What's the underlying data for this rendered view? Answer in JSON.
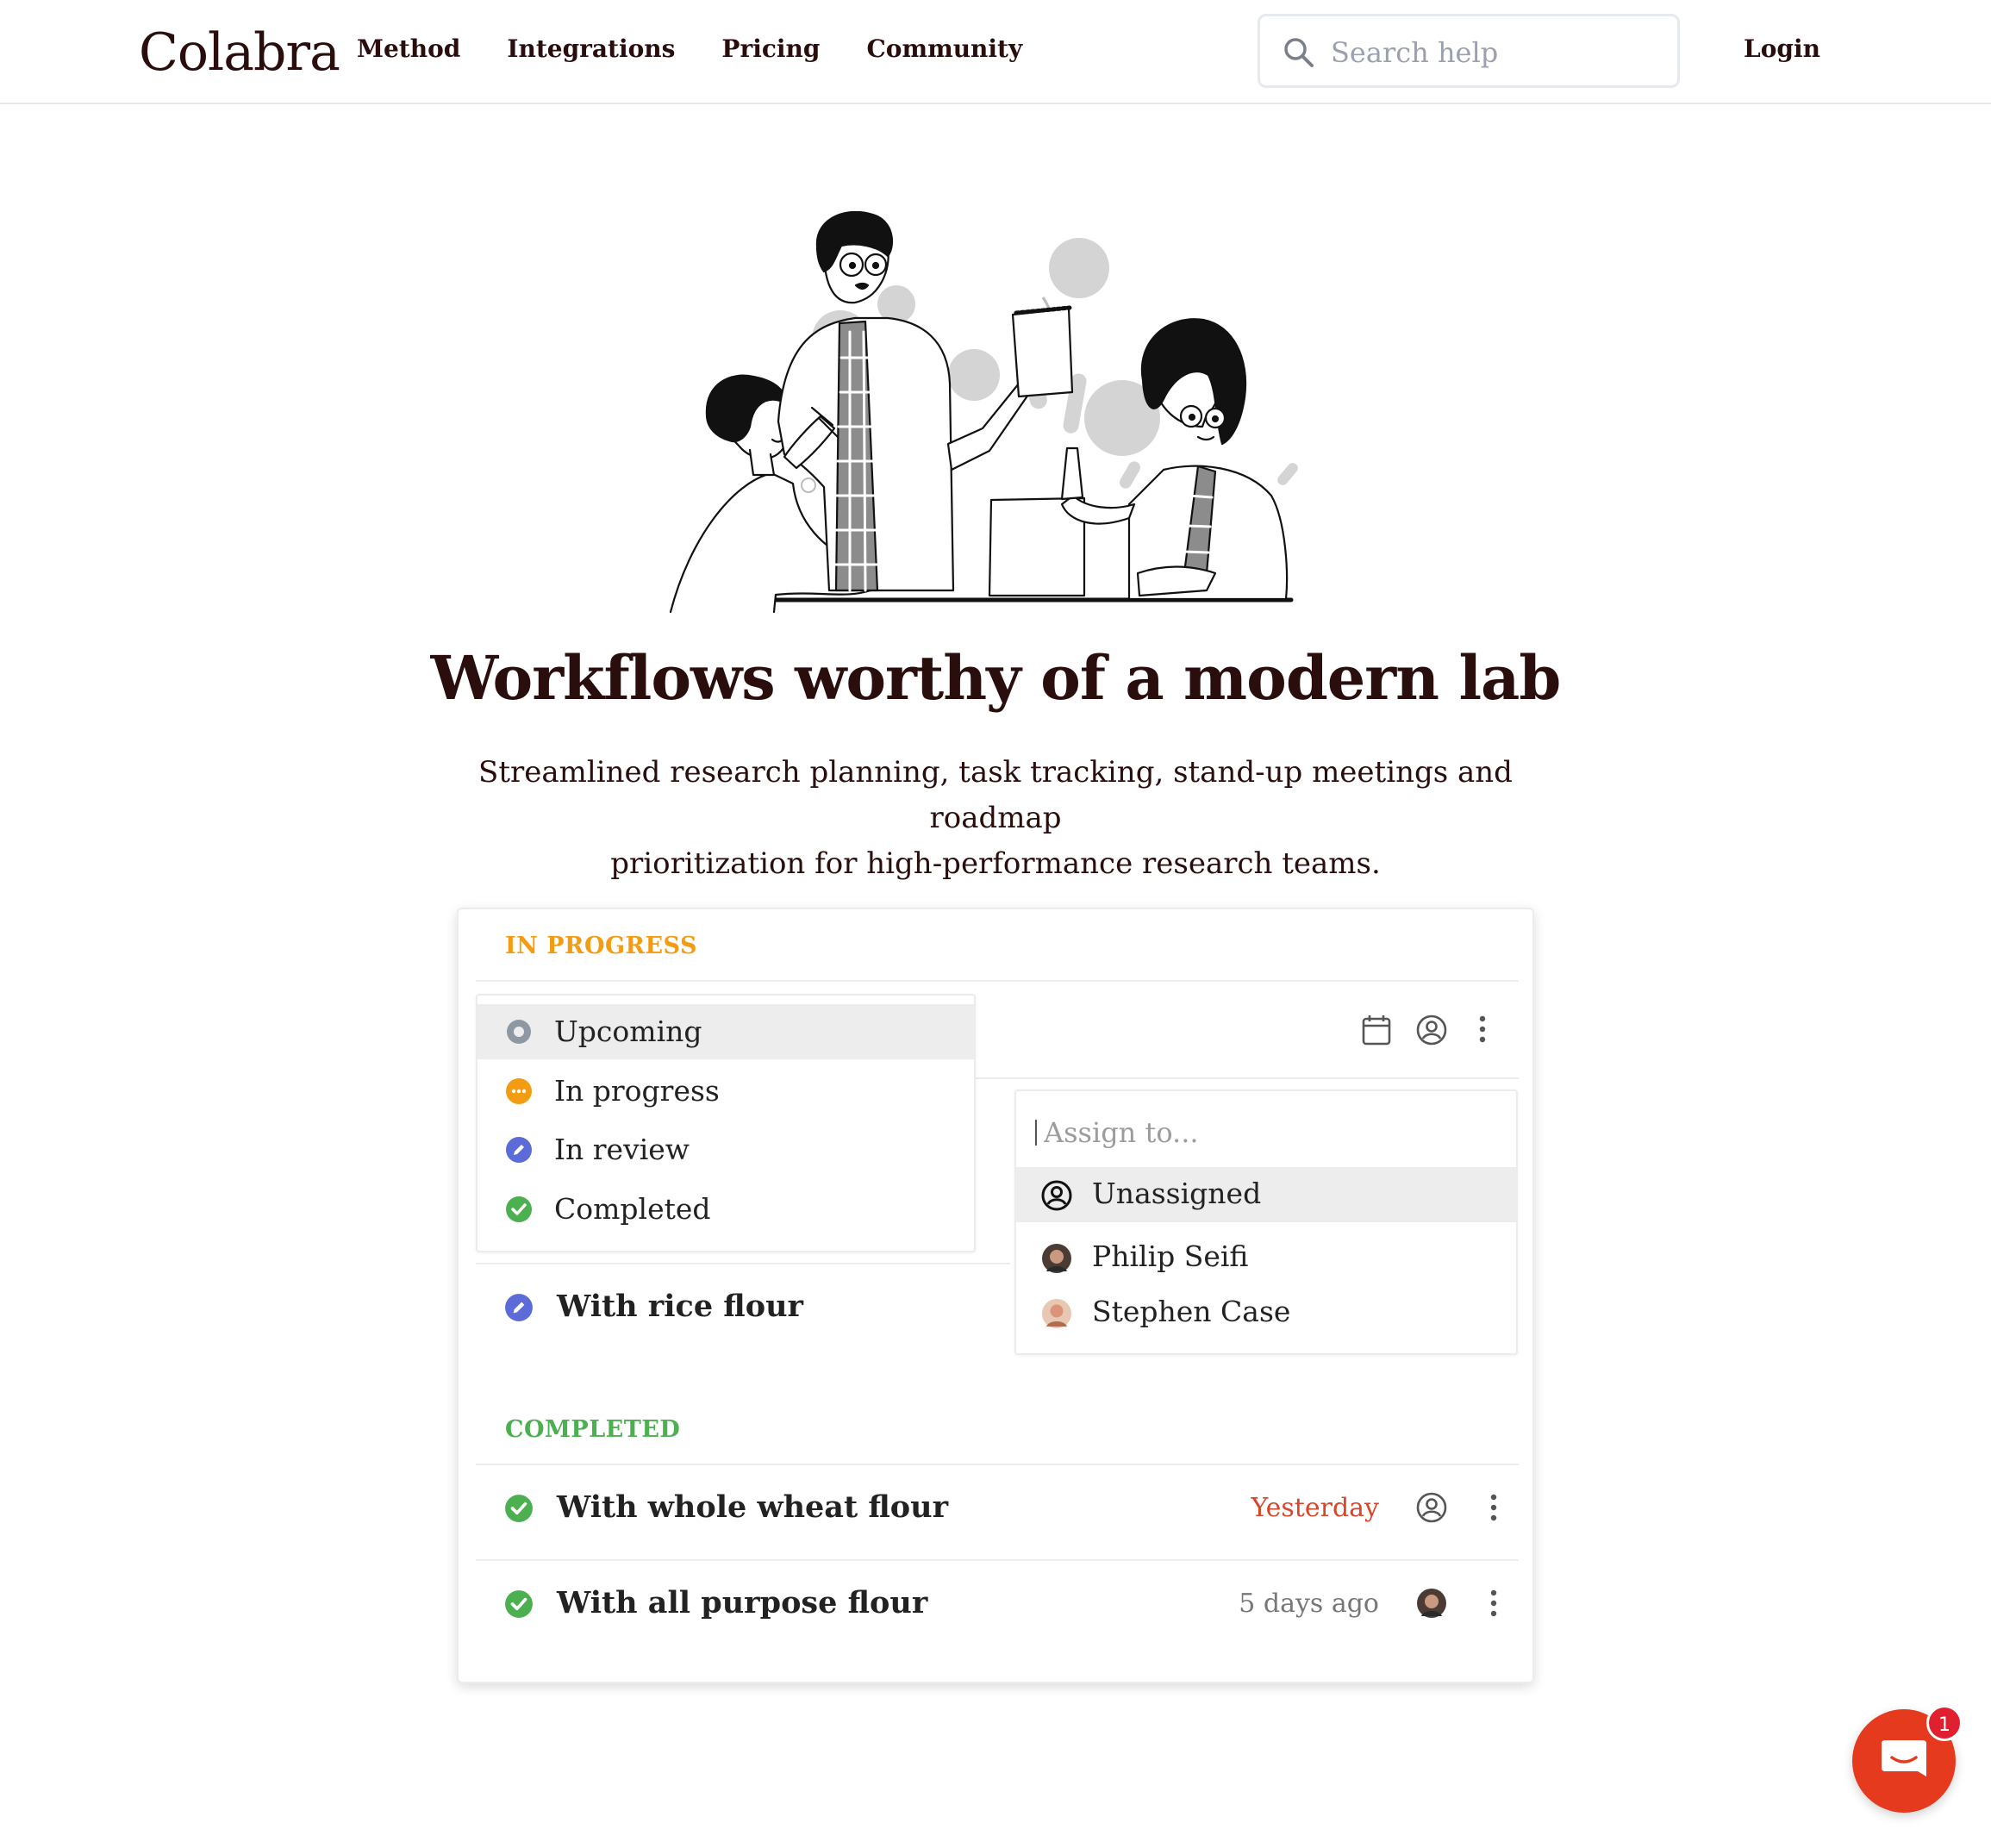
{
  "header": {
    "logo": "Colabra",
    "nav": [
      "Method",
      "Integrations",
      "Pricing",
      "Community"
    ],
    "search_placeholder": "Search help",
    "login_label": "Login"
  },
  "hero": {
    "title": "Workflows worthy of a modern lab",
    "subtitle_line1": "Streamlined research planning, task tracking, stand-up meetings and roadmap",
    "subtitle_line2": "prioritization for high-performance research teams."
  },
  "app": {
    "in_progress_heading": "IN PROGRESS",
    "completed_heading": "COMPLETED",
    "status_options": [
      "Upcoming",
      "In progress",
      "In review",
      "Completed"
    ],
    "assign_placeholder": "Assign to...",
    "assign_options": [
      "Unassigned",
      "Philip Seifi",
      "Stephen Case"
    ],
    "tasks_in_progress": [
      {
        "title": "With rice flour",
        "status": "In review"
      }
    ],
    "tasks_completed": [
      {
        "title": "With whole wheat flour",
        "due": "Yesterday",
        "status": "Completed"
      },
      {
        "title": "With all purpose flour",
        "due": "5 days ago",
        "status": "Completed"
      }
    ],
    "colors": {
      "in_progress": "#f39c12",
      "completed": "#4caf50",
      "review": "#5c6bd8",
      "overdue": "#d9452b",
      "upcoming": "#8e98a3"
    }
  },
  "chat": {
    "badge": "1"
  }
}
